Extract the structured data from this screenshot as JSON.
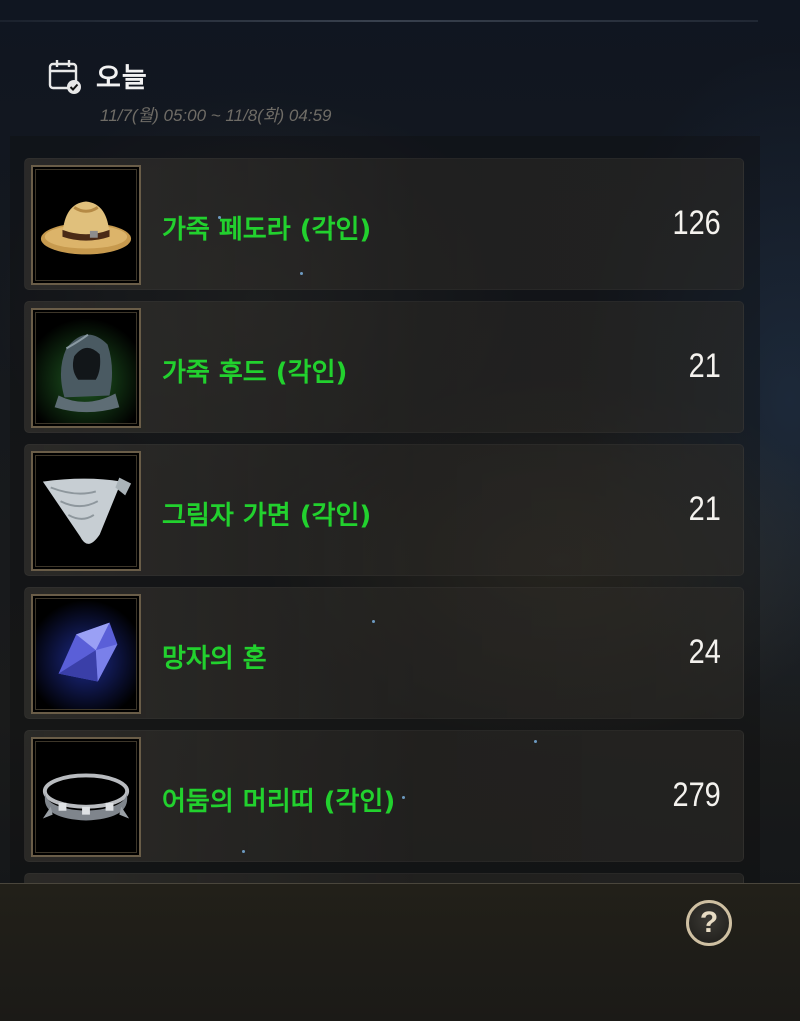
{
  "header": {
    "title": "오늘",
    "date_range": "11/7(월) 05:00 ~ 11/8(화) 04:59"
  },
  "items": [
    {
      "name": "가죽 페도라 (각인)",
      "count": "126",
      "icon": "fedora-hat-icon"
    },
    {
      "name": "가죽 후드 (각인)",
      "count": "21",
      "icon": "leather-hood-icon"
    },
    {
      "name": "그림자 가면 (각인)",
      "count": "21",
      "icon": "shadow-mask-icon"
    },
    {
      "name": "망자의 혼",
      "count": "24",
      "icon": "soul-crystal-icon"
    },
    {
      "name": "어둠의 머리띠 (각인)",
      "count": "279",
      "icon": "dark-headband-icon"
    }
  ],
  "footer": {
    "help_label": "?"
  },
  "colors": {
    "item_name": "#22d12e",
    "count": "#f4f2ee",
    "frame": "#6a5d48"
  }
}
